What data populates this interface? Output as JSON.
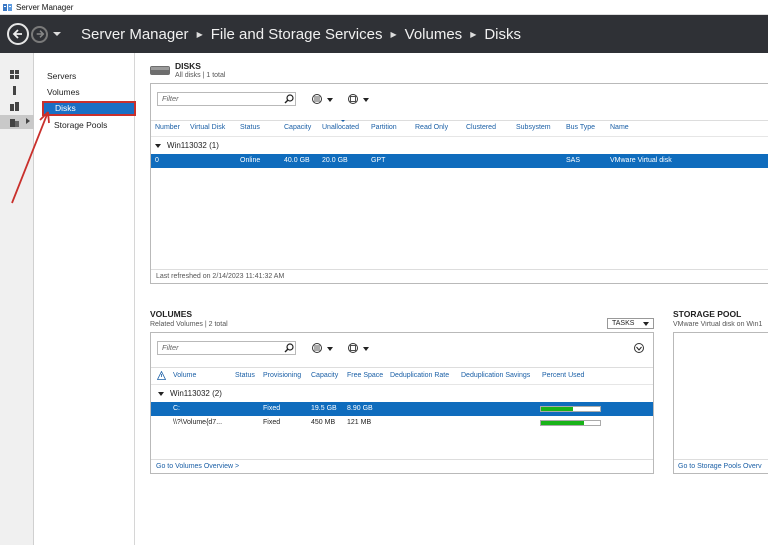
{
  "window": {
    "title": "Server Manager"
  },
  "header": {
    "breadcrumbs": [
      "Server Manager",
      "File and Storage Services",
      "Volumes",
      "Disks"
    ]
  },
  "nav": {
    "items": [
      {
        "label": "Servers"
      },
      {
        "label": "Volumes"
      },
      {
        "label": "Disks"
      },
      {
        "label": "Storage Pools"
      }
    ]
  },
  "disks": {
    "title": "DISKS",
    "subtitle": "All disks | 1 total",
    "filter_placeholder": "Filter",
    "columns": [
      "Number",
      "Virtual Disk",
      "Status",
      "Capacity",
      "Unallocated",
      "Partition",
      "Read Only",
      "Clustered",
      "Subsystem",
      "Bus Type",
      "Name"
    ],
    "group": "Win113032 (1)",
    "rows": [
      {
        "number": "0",
        "virtual_disk": "",
        "status": "Online",
        "capacity": "40.0 GB",
        "unallocated": "20.0 GB",
        "partition": "GPT",
        "read_only": "",
        "clustered": "",
        "subsystem": "",
        "bus_type": "SAS",
        "name": "VMware Virtual disk"
      }
    ],
    "last_refreshed": "Last refreshed on 2/14/2023 11:41:32 AM"
  },
  "volumes": {
    "title": "VOLUMES",
    "subtitle": "Related Volumes | 2 total",
    "tasks_label": "TASKS",
    "filter_placeholder": "Filter",
    "columns": [
      "Volume",
      "Status",
      "Provisioning",
      "Capacity",
      "Free Space",
      "Deduplication Rate",
      "Deduplication Savings",
      "Percent Used"
    ],
    "group": "Win113032 (2)",
    "rows": [
      {
        "volume": "C:",
        "status": "",
        "provisioning": "Fixed",
        "capacity": "19.5 GB",
        "free_space": "8.90 GB",
        "percent_used": 0.55
      },
      {
        "volume": "\\\\?\\Volume{d7...",
        "status": "",
        "provisioning": "Fixed",
        "capacity": "450 MB",
        "free_space": "121 MB",
        "percent_used": 0.73
      }
    ],
    "footer_link": "Go to Volumes Overview >"
  },
  "storage_pool": {
    "title": "STORAGE POOL",
    "subtitle": "VMware Virtual disk on Win1",
    "footer_link": "Go to Storage Pools Overv"
  },
  "colors": {
    "header_bg": "#2f3136",
    "selection": "#0f6cbd",
    "nav_selected": "#1a6fc4",
    "annotation_red": "#c9302c",
    "bar_green": "#19b319"
  }
}
